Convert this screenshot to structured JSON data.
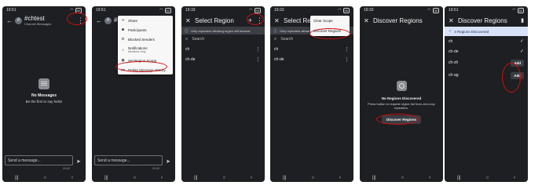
{
  "panels": [
    {
      "status_time": "19:51",
      "battery": "82",
      "channel_name": "#chtest",
      "channel_sub": "Channel Messages",
      "avatar_glyph": "#",
      "empty_title": "No Messages",
      "empty_sub": "Be the first to say hello!",
      "composer_placeholder": "Send a message...",
      "counter": "0/140"
    },
    {
      "status_time": "19:51",
      "battery": "82",
      "channel_name": "#cht",
      "avatar_glyph": "#",
      "composer_placeholder": "Send a message...",
      "counter": "0/140",
      "menu": {
        "share": "Share",
        "participants": "Participants",
        "blocked": "Blocked Senders",
        "notifications": "Notifications",
        "notifications_sub": "Mentions Only",
        "region_scope": "Set Region Scope",
        "delete_history": "Delete Message History"
      }
    },
    {
      "status_time": "19:33",
      "battery": "95",
      "title": "Select Region",
      "banner": "Only repeaters allowing region will forward.",
      "search_placeholder": "Search",
      "rows": [
        "ch",
        "ch-de"
      ]
    },
    {
      "status_time": "19:33",
      "battery": "95",
      "title": "Select Region",
      "banner": "Only repeaters allowing",
      "search_placeholder": "Search",
      "rows": [
        "ch",
        "ch-de"
      ],
      "menu": {
        "clear_scope": "Clear Scope",
        "discover_regions": "Discover Regions"
      }
    },
    {
      "status_time": "19:33",
      "battery": "95",
      "title": "Discover Regions",
      "empty_title": "No Regions Discovered",
      "empty_sub_1": "Press button to request region list from zero-hop",
      "empty_sub_2": "repeaters.",
      "button": "Discover Regions"
    },
    {
      "status_time": "19:51",
      "battery": "82",
      "title": "Discover Regions",
      "banner": "4 Regions Discovered",
      "rows": [
        {
          "name": "ch",
          "state": "checked"
        },
        {
          "name": "ch-de",
          "state": "checked"
        },
        {
          "name": "ch-zh",
          "action": "Add"
        },
        {
          "name": "ch-ag",
          "action": "Add"
        }
      ]
    }
  ],
  "navbar": {
    "recent": "|||",
    "home": "○",
    "back": "‹"
  },
  "icons": {
    "back": "back-arrow-icon",
    "close": "close-icon",
    "kebab": "more-vert-icon",
    "plus": "plus-icon",
    "trash": "trash-icon",
    "send": "send-icon",
    "search": "search-icon",
    "info": "info-icon",
    "check": "check-icon"
  },
  "colors": {
    "phone_bg": "#1d1f22",
    "menu_bg": "#f7f7f8",
    "annotation_red": "#d10e0e",
    "found_banner": "#d7e2f8"
  }
}
